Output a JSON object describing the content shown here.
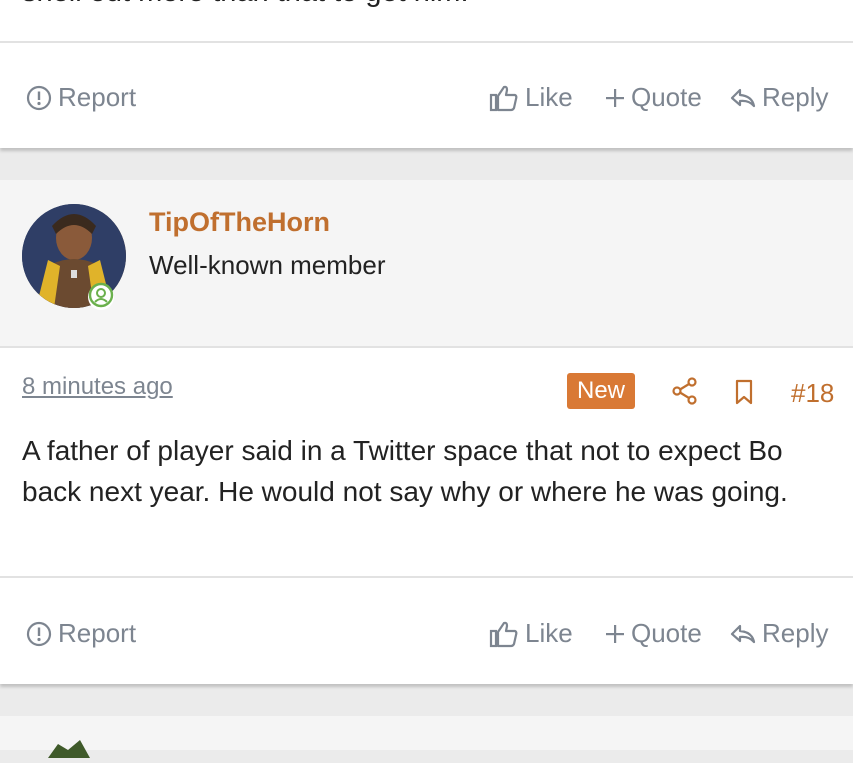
{
  "previous_post": {
    "fragment": "shell out more than that to get him."
  },
  "actions": {
    "report": "Report",
    "like": "Like",
    "quote": "Quote",
    "reply": "Reply"
  },
  "post": {
    "username": "TipOfTheHorn",
    "user_title": "Well-known member",
    "timestamp": "8 minutes ago",
    "badge": "New",
    "post_number": "#18",
    "body": "A father of player said in a Twitter space that not to expect Bo back next year. He would not say why or where he was going."
  },
  "colors": {
    "accent": "#c06f2e",
    "badge": "#d97935",
    "online": "#6ab04c",
    "muted": "#7d8590"
  }
}
